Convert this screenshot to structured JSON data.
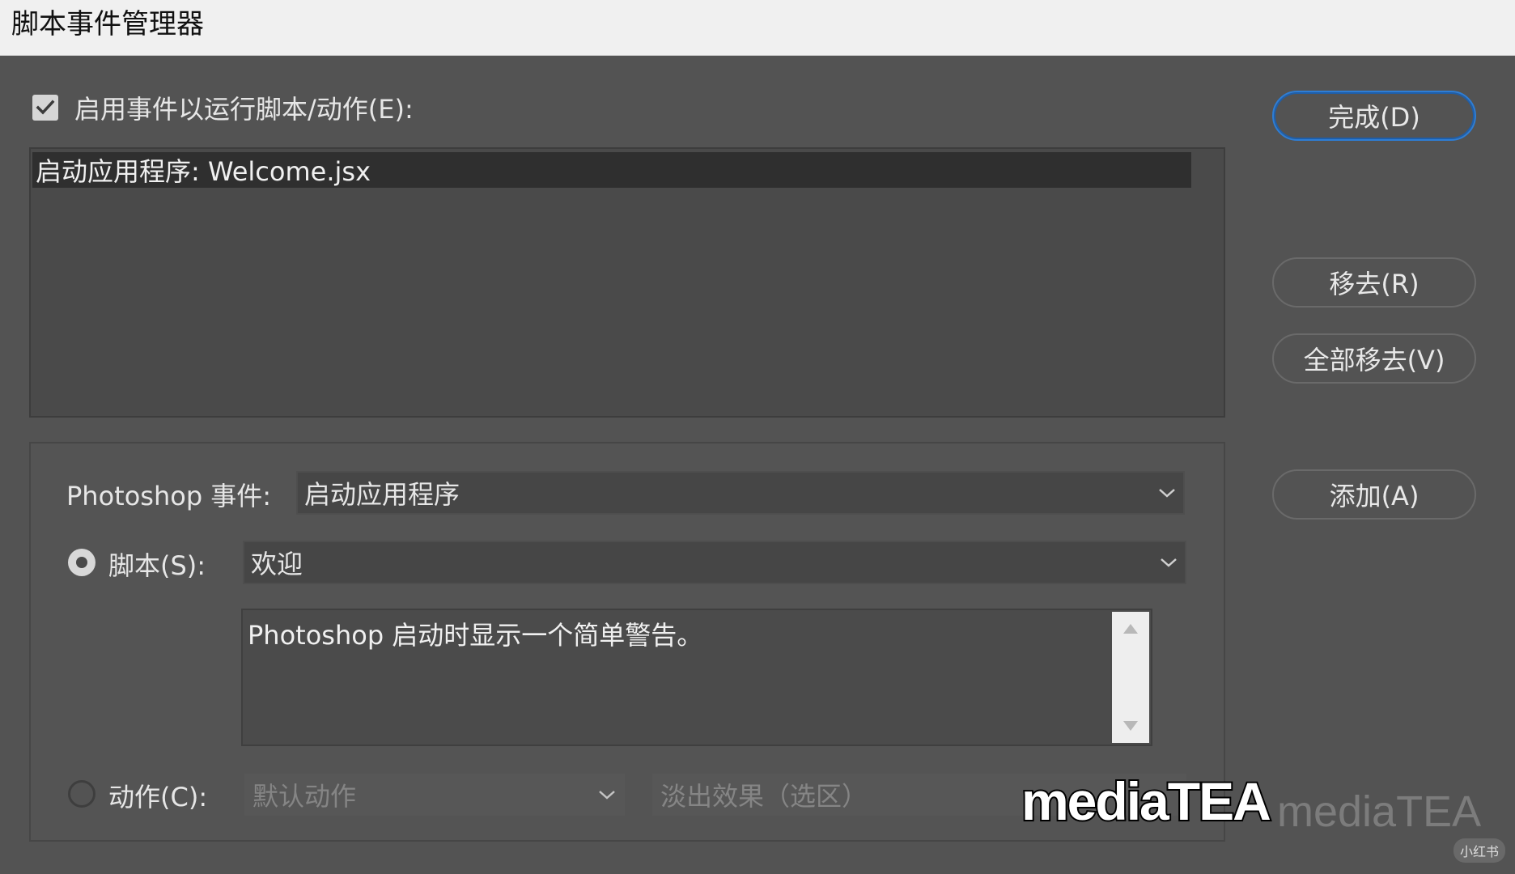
{
  "window": {
    "title": "脚本事件管理器"
  },
  "enable": {
    "checked": true,
    "label": "启用事件以运行脚本/动作(E):"
  },
  "event_list": {
    "items": [
      {
        "label": "启动应用程序: Welcome.jsx",
        "selected": true
      }
    ]
  },
  "buttons": {
    "done": "完成(D)",
    "remove": "移去(R)",
    "remove_all": "全部移去(V)",
    "add": "添加(A)"
  },
  "form": {
    "event_label": "Photoshop 事件:",
    "event_value": "启动应用程序",
    "script_label": "脚本(S):",
    "script_selected": true,
    "script_value": "欢迎",
    "script_description": "Photoshop 启动时显示一个简单警告。",
    "action_label": "动作(C):",
    "action_selected": false,
    "action_set_value": "默认动作",
    "action_value": "淡出效果（选区）"
  },
  "watermarks": {
    "bold": "mediaTEA",
    "faint": "mediaTEA",
    "badge": "小红书"
  },
  "icons": {
    "checkbox": "check-icon",
    "dropdown": "chevron-down-icon",
    "scroll_up": "triangle-up-icon",
    "scroll_down": "triangle-down-icon"
  }
}
